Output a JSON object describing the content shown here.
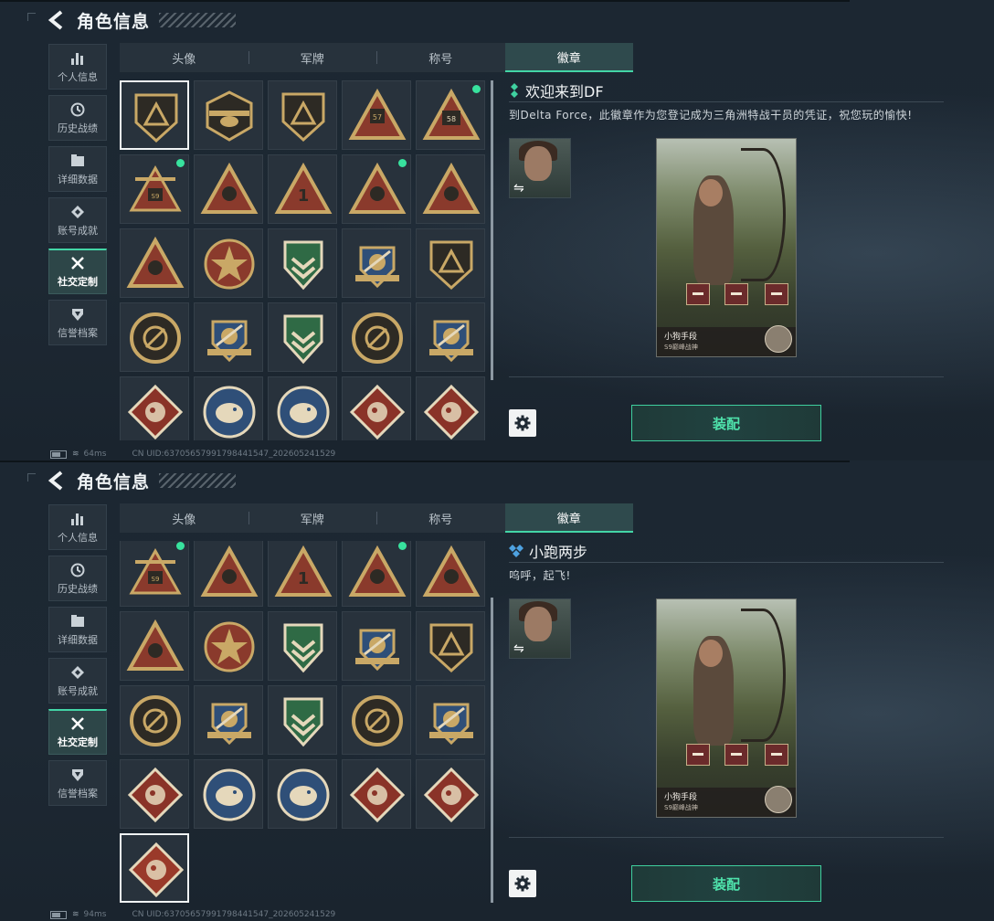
{
  "screens": [
    {
      "header": {
        "title": "角色信息"
      },
      "sidebar": [
        {
          "label": "个人信息",
          "icon": "bar-chart-icon"
        },
        {
          "label": "历史战绩",
          "icon": "clock-icon"
        },
        {
          "label": "详细数据",
          "icon": "folder-icon"
        },
        {
          "label": "账号成就",
          "icon": "diamond-icon"
        },
        {
          "label": "社交定制",
          "icon": "tools-icon",
          "active": true
        },
        {
          "label": "信誉档案",
          "icon": "shield-icon"
        }
      ],
      "tabs": [
        {
          "label": "头像"
        },
        {
          "label": "军牌"
        },
        {
          "label": "称号"
        },
        {
          "label": "徽章",
          "active": true
        }
      ],
      "badges_selected_index": 0,
      "detail": {
        "name": "欢迎来到DF",
        "description": "到Delta Force，此徽章作为您登记成为三角洲特战干员的凭证，祝您玩的愉快!",
        "card_name": "小狗手段",
        "card_sub": "S9巅峰战神",
        "equip_label": "装配"
      },
      "status": {
        "ping": "64ms",
        "uid": "CN UID:6370565799179844154​7_202605241529"
      }
    },
    {
      "header": {
        "title": "角色信息"
      },
      "sidebar": [
        {
          "label": "个人信息",
          "icon": "bar-chart-icon"
        },
        {
          "label": "历史战绩",
          "icon": "clock-icon"
        },
        {
          "label": "详细数据",
          "icon": "folder-icon"
        },
        {
          "label": "账号成就",
          "icon": "diamond-icon"
        },
        {
          "label": "社交定制",
          "icon": "tools-icon",
          "active": true
        },
        {
          "label": "信誉档案",
          "icon": "shield-icon"
        }
      ],
      "tabs": [
        {
          "label": "头像"
        },
        {
          "label": "军牌"
        },
        {
          "label": "称号"
        },
        {
          "label": "徽章",
          "active": true
        }
      ],
      "detail": {
        "name": "小跑两步",
        "description": "呜呼，起飞!",
        "card_name": "小狗手段",
        "card_sub": "S9巅峰战神",
        "equip_label": "装配"
      },
      "status": {
        "ping": "94ms",
        "uid": "CN UID:637056579917984415​47_202605241529"
      }
    }
  ],
  "colors": {
    "accent": "#43d5a6",
    "new_dot": "#38e29e",
    "panel": "#27323c"
  },
  "badges_top": [
    {
      "icon": "pyramid-shield-badge-icon",
      "new": false
    },
    {
      "icon": "helicopter-badge-icon",
      "new": false
    },
    {
      "icon": "dagger-shield-badge-icon",
      "new": false
    },
    {
      "icon": "s7-triangle-badge-icon",
      "new": false
    },
    {
      "icon": "s8-triangle-badge-icon",
      "new": true
    },
    {
      "icon": "s9-winged-badge-icon",
      "new": true
    },
    {
      "icon": "sail-triangle-badge-icon",
      "new": false
    },
    {
      "icon": "number-one-triangle-badge-icon",
      "new": false
    },
    {
      "icon": "lighter-triangle-badge-icon",
      "new": true
    },
    {
      "icon": "gem-triangle-badge-icon",
      "new": false
    },
    {
      "icon": "soldiers-triangle-badge-icon",
      "new": false
    },
    {
      "icon": "star-emblem-badge-icon",
      "new": false
    },
    {
      "icon": "green-chevron-shield-badge-icon",
      "new": false
    },
    {
      "icon": "starred-crest-badge-icon",
      "new": false
    },
    {
      "icon": "d20-shield-badge-icon",
      "new": false
    },
    {
      "icon": "skull-round-badge-icon",
      "new": false
    },
    {
      "icon": "rifle-crest-badge-icon",
      "new": false
    },
    {
      "icon": "green-rifle-badge-icon",
      "new": false
    },
    {
      "icon": "knife-ring-badge-icon",
      "new": false
    },
    {
      "icon": "rifle-crest-gold-badge-icon",
      "new": false
    },
    {
      "icon": "wolf-diamond-badge-icon",
      "new": false
    },
    {
      "icon": "eagle-round-badge-icon",
      "new": false
    },
    {
      "icon": "eagle-round-badge-icon",
      "new": false
    },
    {
      "icon": "dragon-diamond-badge-icon",
      "new": false
    },
    {
      "icon": "dragon-diamond-badge-icon",
      "new": false
    }
  ],
  "badges_bottom": [
    {
      "icon": "s9-winged-badge-icon",
      "new": true
    },
    {
      "icon": "sail-triangle-badge-icon",
      "new": false
    },
    {
      "icon": "number-one-triangle-badge-icon",
      "new": false
    },
    {
      "icon": "lighter-triangle-badge-icon",
      "new": true
    },
    {
      "icon": "gem-triangle-badge-icon",
      "new": false
    },
    {
      "icon": "soldiers-triangle-badge-icon",
      "new": false
    },
    {
      "icon": "star-emblem-badge-icon",
      "new": false
    },
    {
      "icon": "green-chevron-shield-badge-icon",
      "new": false
    },
    {
      "icon": "starred-crest-badge-icon",
      "new": false
    },
    {
      "icon": "d20-shield-badge-icon",
      "new": false
    },
    {
      "icon": "skull-round-badge-icon",
      "new": false
    },
    {
      "icon": "rifle-crest-badge-icon",
      "new": false
    },
    {
      "icon": "green-rifle-badge-icon",
      "new": false
    },
    {
      "icon": "knife-ring-badge-icon",
      "new": false
    },
    {
      "icon": "rifle-crest-gold-badge-icon",
      "new": false
    },
    {
      "icon": "wolf-diamond-badge-icon",
      "new": false
    },
    {
      "icon": "eagle-round-badge-icon",
      "new": false
    },
    {
      "icon": "eagle-round-badge-icon",
      "new": false
    },
    {
      "icon": "dragon-diamond-badge-icon",
      "new": false
    },
    {
      "icon": "dragon-diamond-badge-icon",
      "new": false
    },
    {
      "icon": "runner-diamond-badge-icon",
      "new": false,
      "selected": true
    }
  ]
}
